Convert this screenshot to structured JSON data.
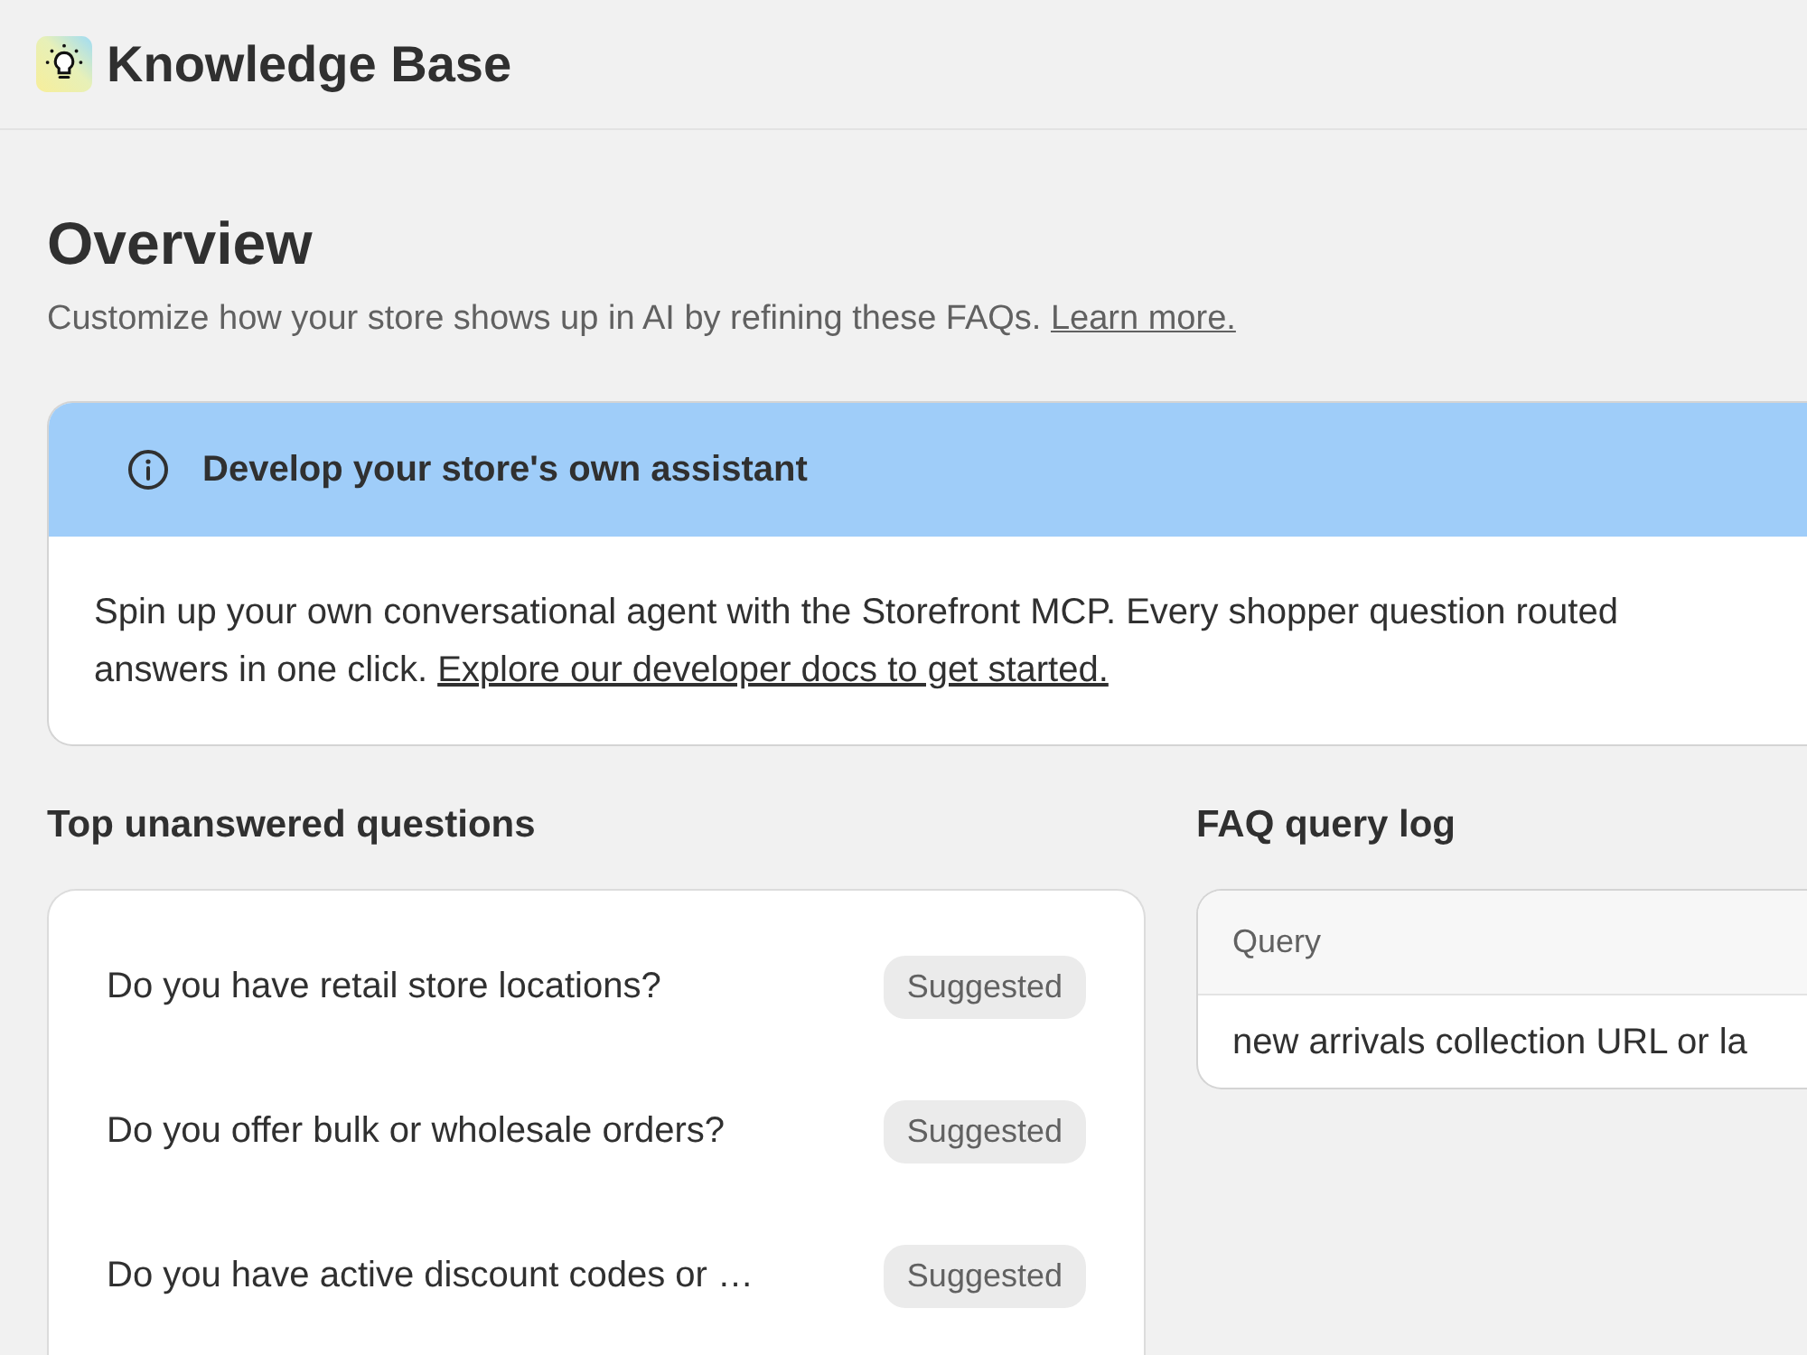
{
  "header": {
    "title": "Knowledge Base"
  },
  "page": {
    "title": "Overview",
    "subtitle": "Customize how your store shows up in AI by refining these FAQs.",
    "subtitle_link": "Learn more."
  },
  "banner": {
    "title": "Develop your store's own assistant",
    "body": "Spin up your own conversational agent with the Storefront MCP. Every shopper question routed answers in one click.",
    "link": "Explore our developer docs to get started."
  },
  "questions": {
    "title": "Top unanswered questions",
    "items": [
      {
        "text": "Do you have retail store locations?",
        "badge": "Suggested"
      },
      {
        "text": "Do you offer bulk or wholesale orders?",
        "badge": "Suggested"
      },
      {
        "text": "Do you have active discount codes or …",
        "badge": "Suggested"
      }
    ]
  },
  "query_log": {
    "title": "FAQ query log",
    "columns": [
      "Query"
    ],
    "rows": [
      [
        "new arrivals collection URL or la"
      ]
    ]
  }
}
